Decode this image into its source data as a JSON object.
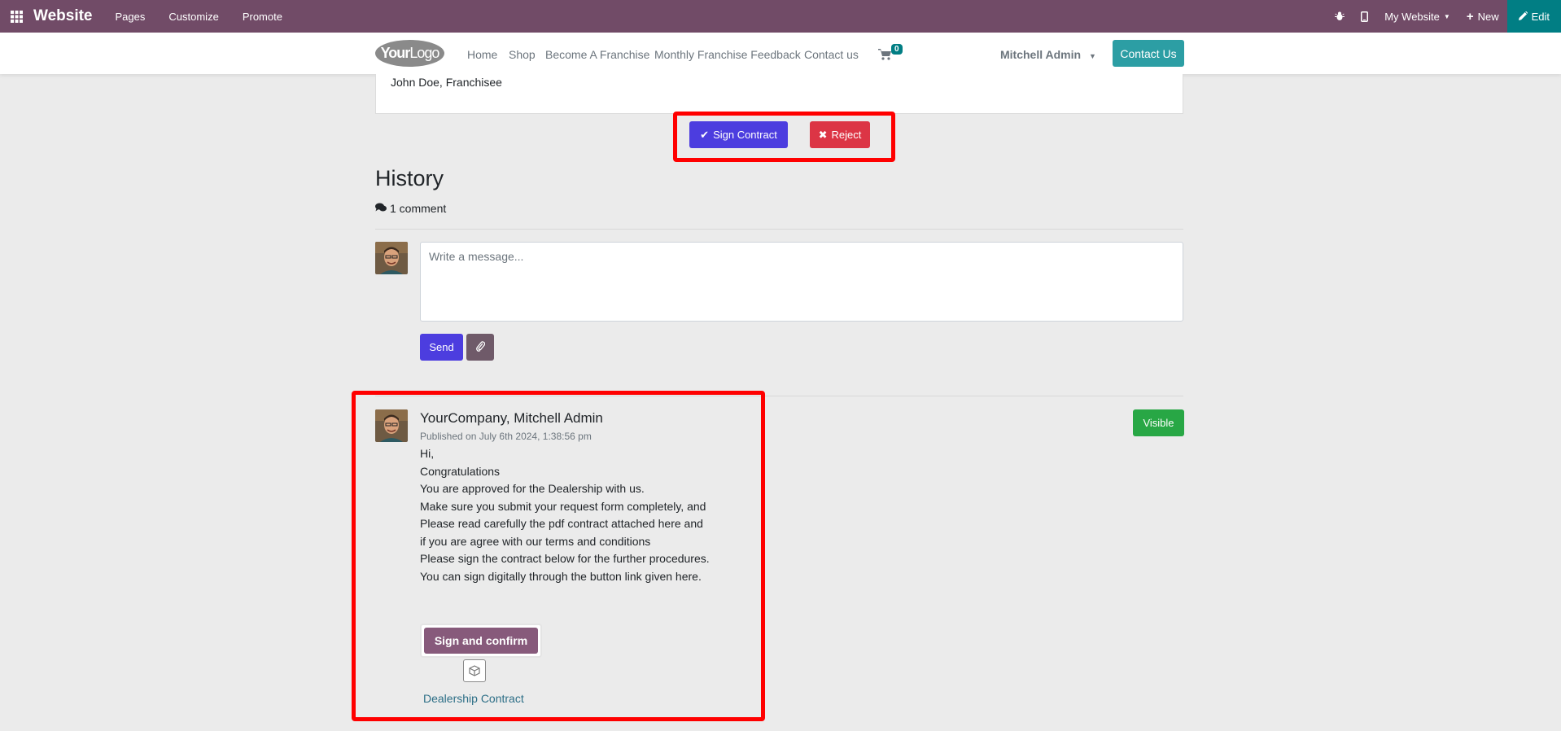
{
  "adminbar": {
    "brand": "Website",
    "menu": [
      "Pages",
      "Customize",
      "Promote"
    ],
    "website_selector": "My Website",
    "new_label": "New",
    "edit_label": "Edit",
    "bg_color": "#714b67",
    "edit_color": "#017e84"
  },
  "navbar": {
    "logo_your": "Your",
    "logo_logo": "Logo",
    "links": [
      "Home",
      "Shop",
      "Become A Franchise",
      "Monthly Franchise Feedback",
      "Contact us"
    ],
    "cart_count": "0",
    "user_name": "Mitchell Admin",
    "contact_button": "Contact Us"
  },
  "document": {
    "signature_line": "John Doe, Franchisee",
    "sign_contract_label": "Sign Contract",
    "reject_label": "Reject"
  },
  "history": {
    "title": "History",
    "comment_count": "1 comment",
    "composer_placeholder": "Write a message...",
    "send_label": "Send"
  },
  "message": {
    "author": "YourCompany, Mitchell Admin",
    "published": "Published on July 6th 2024, 1:38:56 pm",
    "visibility_label": "Visible",
    "body_lines": [
      "Hi,",
      "Congratulations",
      "You are approved for the Dealership with us.",
      "Make sure you submit your request form completely, and",
      "Please read carefully the pdf contract attached here and",
      "if you are agree with our terms and conditions",
      "Please sign the contract below for the further procedures.",
      "You can sign digitally through the button link given here."
    ],
    "sign_confirm_label": "Sign and confirm",
    "attachment_name": "Dealership Contract"
  },
  "colors": {
    "primary": "#4c3ddf",
    "danger": "#dc3545",
    "success": "#28a745",
    "highlight": "#ff0000",
    "teal": "#2c9ea4"
  }
}
